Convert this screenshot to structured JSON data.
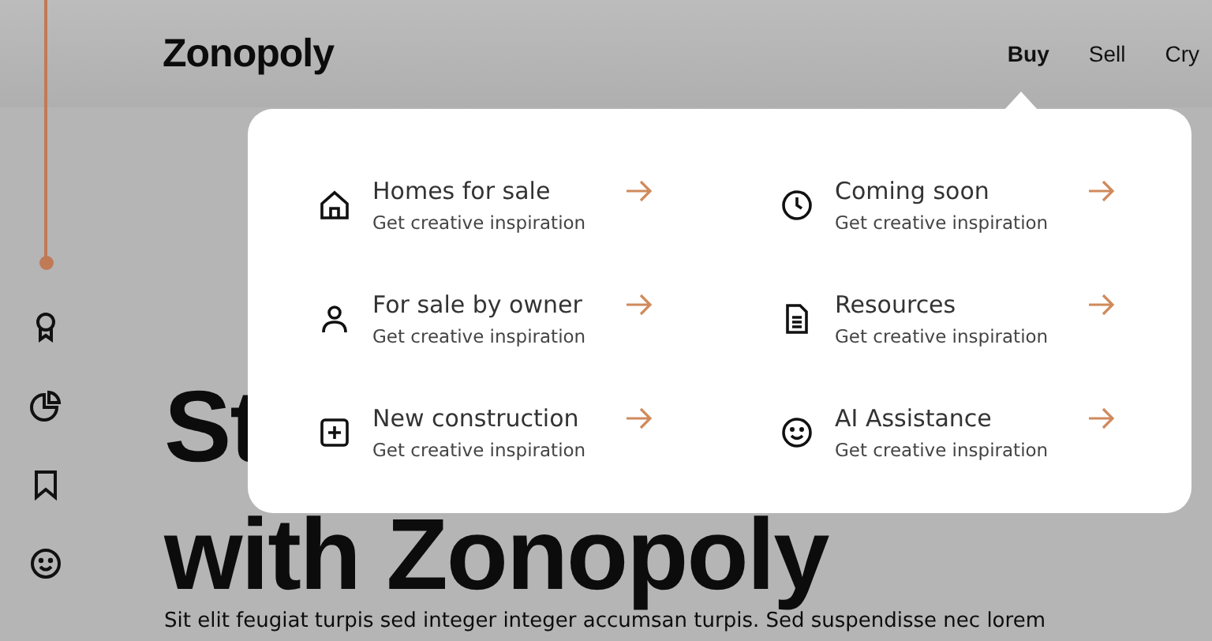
{
  "logo": "Zonopoly",
  "nav": [
    {
      "label": "Buy",
      "selected": true
    },
    {
      "label": "Sell",
      "selected": false
    },
    {
      "label": "Cry",
      "selected": false
    }
  ],
  "dropdown": {
    "items": [
      {
        "title": "Homes for sale",
        "subtitle": "Get creative inspiration"
      },
      {
        "title": "Coming soon",
        "subtitle": "Get creative inspiration"
      },
      {
        "title": "For sale by owner",
        "subtitle": "Get creative inspiration"
      },
      {
        "title": "Resources",
        "subtitle": "Get creative inspiration"
      },
      {
        "title": "New construction",
        "subtitle": "Get creative inspiration"
      },
      {
        "title": "AI Assistance",
        "subtitle": "Get creative inspiration"
      }
    ]
  },
  "hero": {
    "heading_lines": [
      "St",
      "with Zonopoly"
    ],
    "text": "Sit elit feugiat turpis sed integer integer accumsan turpis. Sed suspendisse nec lorem"
  }
}
